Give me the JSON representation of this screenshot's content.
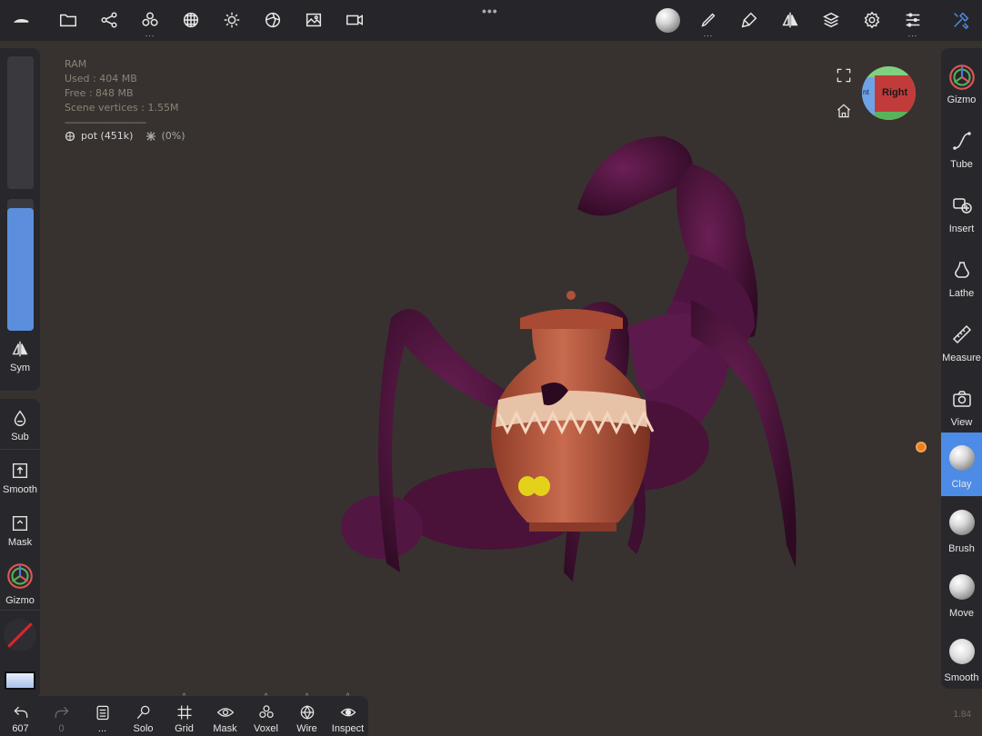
{
  "topbar": {
    "grip": "•••",
    "icons": [
      "logo-icon",
      "folder-icon",
      "scene-graph-icon",
      "primitives-icon",
      "sphere-mesh-icon",
      "light-icon",
      "material-icon",
      "image-icon",
      "video-icon"
    ],
    "right_icons": [
      "matcap-icon",
      "paint-icon",
      "brush-stroke-icon",
      "symmetry-icon",
      "layers-icon",
      "settings-icon",
      "sliders-icon",
      "tools-icon"
    ],
    "more": "..."
  },
  "stats": {
    "ram": "RAM",
    "used": "Used : 404 MB",
    "free": "Free : 848 MB",
    "vertices": "Scene vertices : 1.55M",
    "separator": "------------------------------",
    "object_name": "pot (451k)",
    "object_percent": "(0%)"
  },
  "gizmo_cube": {
    "face": "Right",
    "left_face": "nt"
  },
  "left_panel": {
    "size_slider_value": 0,
    "intensity_slider_value": 1.0,
    "sym": "Sym",
    "sub": "Sub",
    "smooth": "Smooth",
    "mask": "Mask",
    "gizmo": "Gizmo"
  },
  "right_panel": {
    "gizmo": "Gizmo",
    "tube": "Tube",
    "insert": "Insert",
    "lathe": "Lathe",
    "measure": "Measure",
    "view": "View",
    "clay": "Clay",
    "brush": "Brush",
    "move": "Move",
    "smooth": "Smooth"
  },
  "bottombar": {
    "undo_count": "607",
    "redo_count": "0",
    "more": "...",
    "solo": "Solo",
    "grid": "Grid",
    "mask": "Mask",
    "voxel": "Voxel",
    "wire": "Wire",
    "inspect": "Inspect"
  },
  "version": "1.84",
  "colors": {
    "accent": "#4d8ce6",
    "background": "#37322f",
    "panel": "#28282c",
    "creature": "#4a1238",
    "pot": "#b0523a",
    "pivot": "#e8801f"
  }
}
